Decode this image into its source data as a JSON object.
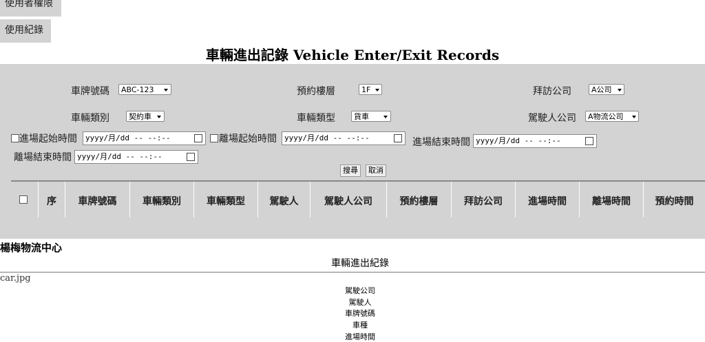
{
  "nav": {
    "permissions": "使用者權限",
    "usage_log": "使用紀錄"
  },
  "title": "車輛進出記錄 Vehicle Enter/Exit Records",
  "filters": {
    "plate_label": "車牌號碼",
    "plate_value": "ABC-123",
    "floor_label": "預約樓層",
    "floor_value": "1F",
    "visit_company_label": "拜訪公司",
    "visit_company_value": "A公司",
    "category_label": "車輛類別",
    "category_value": "契約車",
    "type_label": "車輛類型",
    "type_value": "貨車",
    "driver_company_label": "駕駛人公司",
    "driver_company_value": "A物流公司",
    "entry_start_label": "進場起始時間",
    "entry_start_value": "yyyy/月/dd -- --:--",
    "exit_start_label": "離場起始時間",
    "exit_start_value": "yyyy/月/dd -- --:--",
    "entry_end_label": "進場結束時間",
    "entry_end_value": "yyyy/月/dd -- --:--",
    "exit_end_label": "離場結束時間",
    "exit_end_value": "yyyy/月/dd -- --:--",
    "search_button": "搜尋",
    "cancel_button": "取消"
  },
  "table": {
    "headers": [
      "序",
      "車牌號碼",
      "車輛類別",
      "車輛類型",
      "駕駛人",
      "駕駛人公司",
      "預約樓層",
      "拜訪公司",
      "進場時間",
      "離場時間",
      "預約時間"
    ]
  },
  "report": {
    "company": "楊梅物流中心",
    "subtitle": "車輛進出紀錄",
    "image_alt": "car.jpg",
    "fields": [
      "駕駛公司",
      "駕駛人",
      "車牌號碼",
      "車種",
      "進場時間"
    ]
  }
}
